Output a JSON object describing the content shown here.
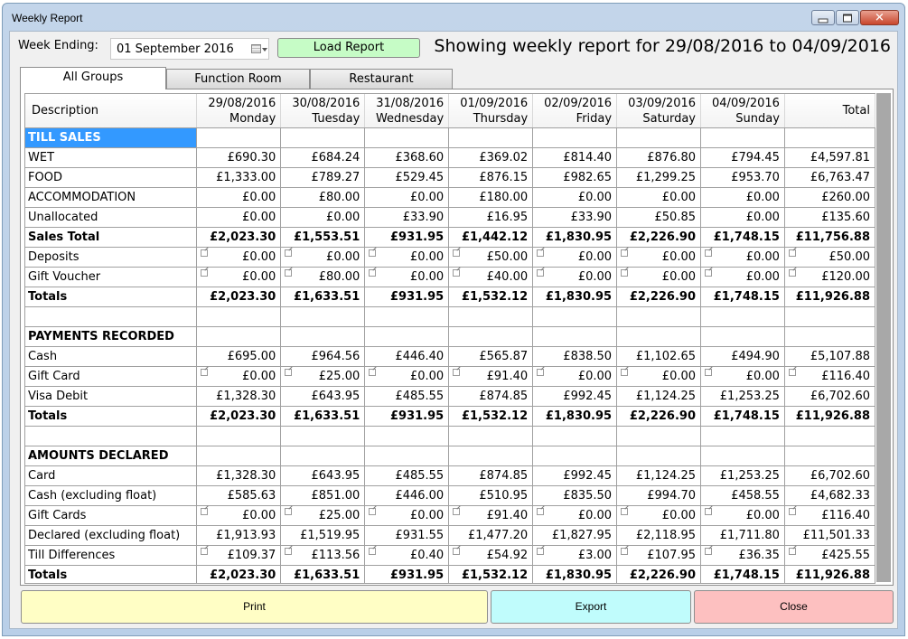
{
  "window": {
    "title": "Weekly Report",
    "controls": [
      "minimize",
      "maximize",
      "close"
    ]
  },
  "toolbar": {
    "week_ending_label": "Week Ending:",
    "week_ending_value": "01 September 2016",
    "load_report_label": "Load Report",
    "heading": "Showing weekly report for 29/08/2016 to 04/09/2016"
  },
  "tabs": [
    {
      "label": "All Groups",
      "active": true
    },
    {
      "label": "Function Room",
      "active": false
    },
    {
      "label": "Restaurant",
      "active": false
    }
  ],
  "grid": {
    "columns": [
      {
        "line1": "",
        "line2": "Description"
      },
      {
        "line1": "29/08/2016",
        "line2": "Monday"
      },
      {
        "line1": "30/08/2016",
        "line2": "Tuesday"
      },
      {
        "line1": "31/08/2016",
        "line2": "Wednesday"
      },
      {
        "line1": "01/09/2016",
        "line2": "Thursday"
      },
      {
        "line1": "02/09/2016",
        "line2": "Friday"
      },
      {
        "line1": "03/09/2016",
        "line2": "Saturday"
      },
      {
        "line1": "04/09/2016",
        "line2": "Sunday"
      },
      {
        "line1": "",
        "line2": "Total"
      }
    ],
    "rows": [
      {
        "type": "section",
        "label": "TILL SALES",
        "selected": true,
        "values": [
          "",
          "",
          "",
          "",
          "",
          "",
          "",
          ""
        ]
      },
      {
        "type": "normal",
        "label": "WET",
        "values": [
          "£690.30",
          "£684.24",
          "£368.60",
          "£369.02",
          "£814.40",
          "£876.80",
          "£794.45",
          "£4,597.81"
        ]
      },
      {
        "type": "normal",
        "label": "FOOD",
        "values": [
          "£1,333.00",
          "£789.27",
          "£529.45",
          "£876.15",
          "£982.65",
          "£1,299.25",
          "£953.70",
          "£6,763.47"
        ]
      },
      {
        "type": "normal",
        "label": "ACCOMMODATION",
        "values": [
          "£0.00",
          "£80.00",
          "£0.00",
          "£180.00",
          "£0.00",
          "£0.00",
          "£0.00",
          "£260.00"
        ]
      },
      {
        "type": "normal",
        "label": "Unallocated",
        "values": [
          "£0.00",
          "£0.00",
          "£33.90",
          "£16.95",
          "£33.90",
          "£50.85",
          "£0.00",
          "£135.60"
        ]
      },
      {
        "type": "bold",
        "label": "Sales Total",
        "values": [
          "£2,023.30",
          "£1,553.51",
          "£931.95",
          "£1,442.12",
          "£1,830.95",
          "£2,226.90",
          "£1,748.15",
          "£11,756.88"
        ]
      },
      {
        "type": "link",
        "label": "Deposits",
        "values": [
          "£0.00",
          "£0.00",
          "£0.00",
          "£50.00",
          "£0.00",
          "£0.00",
          "£0.00",
          "£50.00"
        ]
      },
      {
        "type": "link",
        "label": "Gift Voucher",
        "values": [
          "£0.00",
          "£80.00",
          "£0.00",
          "£40.00",
          "£0.00",
          "£0.00",
          "£0.00",
          "£120.00"
        ]
      },
      {
        "type": "bold",
        "label": "Totals",
        "values": [
          "£2,023.30",
          "£1,633.51",
          "£931.95",
          "£1,532.12",
          "£1,830.95",
          "£2,226.90",
          "£1,748.15",
          "£11,926.88"
        ]
      },
      {
        "type": "blank",
        "label": "",
        "values": [
          "",
          "",
          "",
          "",
          "",
          "",
          "",
          ""
        ]
      },
      {
        "type": "section",
        "label": "PAYMENTS RECORDED",
        "values": [
          "",
          "",
          "",
          "",
          "",
          "",
          "",
          ""
        ]
      },
      {
        "type": "normal",
        "label": "Cash",
        "values": [
          "£695.00",
          "£964.56",
          "£446.40",
          "£565.87",
          "£838.50",
          "£1,102.65",
          "£494.90",
          "£5,107.88"
        ]
      },
      {
        "type": "link",
        "label": "Gift Card",
        "values": [
          "£0.00",
          "£25.00",
          "£0.00",
          "£91.40",
          "£0.00",
          "£0.00",
          "£0.00",
          "£116.40"
        ]
      },
      {
        "type": "normal",
        "label": "Visa Debit",
        "values": [
          "£1,328.30",
          "£643.95",
          "£485.55",
          "£874.85",
          "£992.45",
          "£1,124.25",
          "£1,253.25",
          "£6,702.60"
        ]
      },
      {
        "type": "bold",
        "label": "Totals",
        "values": [
          "£2,023.30",
          "£1,633.51",
          "£931.95",
          "£1,532.12",
          "£1,830.95",
          "£2,226.90",
          "£1,748.15",
          "£11,926.88"
        ]
      },
      {
        "type": "blank",
        "label": "",
        "values": [
          "",
          "",
          "",
          "",
          "",
          "",
          "",
          ""
        ]
      },
      {
        "type": "section",
        "label": "AMOUNTS DECLARED",
        "values": [
          "",
          "",
          "",
          "",
          "",
          "",
          "",
          ""
        ]
      },
      {
        "type": "normal",
        "label": "Card",
        "values": [
          "£1,328.30",
          "£643.95",
          "£485.55",
          "£874.85",
          "£992.45",
          "£1,124.25",
          "£1,253.25",
          "£6,702.60"
        ]
      },
      {
        "type": "normal",
        "label": "Cash (excluding float)",
        "values": [
          "£585.63",
          "£851.00",
          "£446.00",
          "£510.95",
          "£835.50",
          "£994.70",
          "£458.55",
          "£4,682.33"
        ]
      },
      {
        "type": "link",
        "label": "Gift Cards",
        "values": [
          "£0.00",
          "£25.00",
          "£0.00",
          "£91.40",
          "£0.00",
          "£0.00",
          "£0.00",
          "£116.40"
        ]
      },
      {
        "type": "normal",
        "label": "Declared (excluding float)",
        "values": [
          "£1,913.93",
          "£1,519.95",
          "£931.55",
          "£1,477.20",
          "£1,827.95",
          "£2,118.95",
          "£1,711.80",
          "£11,501.33"
        ]
      },
      {
        "type": "link",
        "label": "Till Differences",
        "values": [
          "£109.37",
          "£113.56",
          "£0.40",
          "£54.92",
          "£3.00",
          "£107.95",
          "£36.35",
          "£425.55"
        ]
      },
      {
        "type": "bold",
        "label": "Totals",
        "values": [
          "£2,023.30",
          "£1,633.51",
          "£931.95",
          "£1,532.12",
          "£1,830.95",
          "£2,226.90",
          "£1,748.15",
          "£11,926.88"
        ]
      }
    ]
  },
  "buttons": {
    "print": {
      "label": "Print",
      "color": "#fffec5"
    },
    "export": {
      "label": "Export",
      "color": "#c0fcfc"
    },
    "close": {
      "label": "Close",
      "color": "#fdc0c0"
    }
  },
  "colors": {
    "selected_cell": "#3399ff",
    "load_button": "#c6fcc6"
  }
}
